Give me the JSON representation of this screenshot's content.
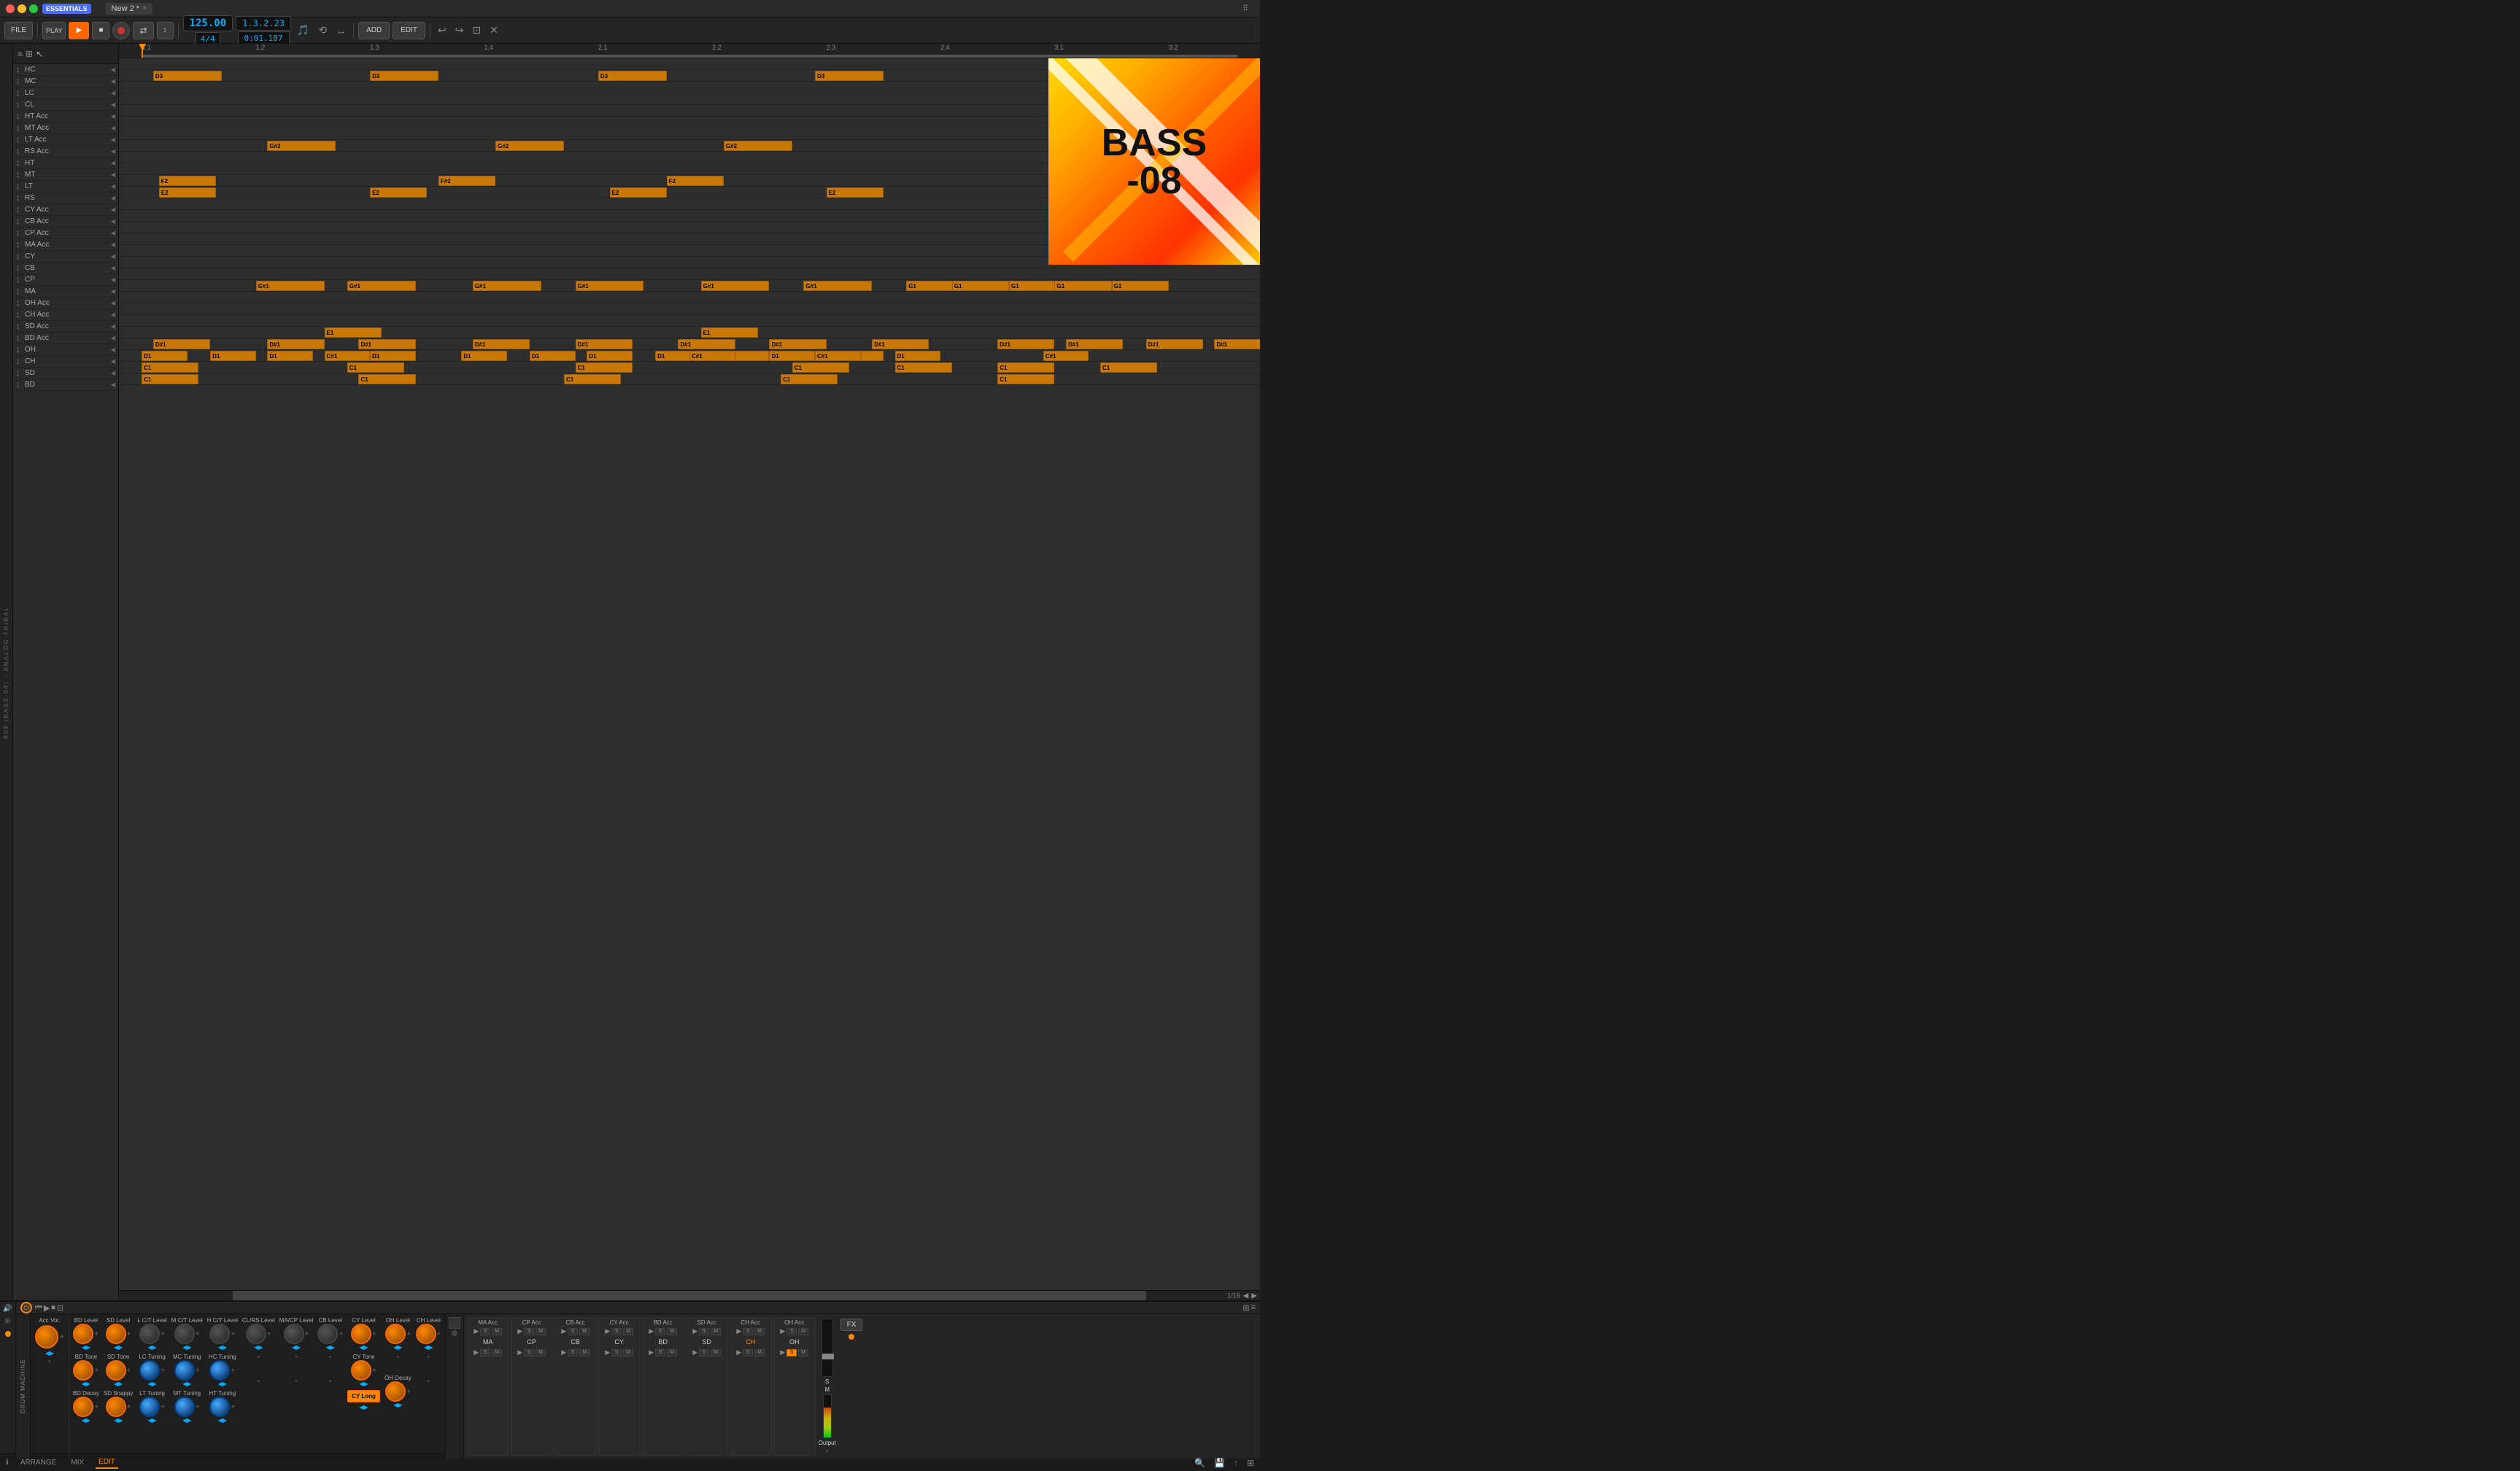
{
  "app": {
    "title": "ESSENTIALS",
    "tab_name": "New 2 *",
    "tab_close": "×"
  },
  "toolbar": {
    "file": "FILE",
    "play": "▶",
    "stop": "■",
    "record": "●",
    "tempo": "125.00",
    "time_sig": "4/4",
    "position": "1.3.2.23",
    "time": "0:01.107",
    "add": "ADD",
    "edit": "EDIT",
    "undo_icon": "↩",
    "redo_icon": "↪"
  },
  "arrange": {
    "ruler_marks": [
      "1.1",
      "1.2",
      "1.3",
      "1.4",
      "2.1",
      "2.2",
      "2.3",
      "2.4",
      "3.1",
      "3.2"
    ],
    "quantize": "1/16"
  },
  "tracks": [
    {
      "num": "1",
      "name": "HC"
    },
    {
      "num": "1",
      "name": "MC"
    },
    {
      "num": "1",
      "name": "LC"
    },
    {
      "num": "1",
      "name": "CL"
    },
    {
      "num": "1",
      "name": "HT Acc"
    },
    {
      "num": "1",
      "name": "MT Acc"
    },
    {
      "num": "1",
      "name": "LT Acc"
    },
    {
      "num": "1",
      "name": "RS Acc"
    },
    {
      "num": "1",
      "name": "HT"
    },
    {
      "num": "1",
      "name": "MT"
    },
    {
      "num": "1",
      "name": "LT"
    },
    {
      "num": "1",
      "name": "RS"
    },
    {
      "num": "1",
      "name": "CY Acc"
    },
    {
      "num": "1",
      "name": "CB Acc"
    },
    {
      "num": "1",
      "name": "CP Acc"
    },
    {
      "num": "1",
      "name": "MA Acc"
    },
    {
      "num": "1",
      "name": "CY"
    },
    {
      "num": "1",
      "name": "CB"
    },
    {
      "num": "1",
      "name": "CP"
    },
    {
      "num": "1",
      "name": "MA"
    },
    {
      "num": "1",
      "name": "OH Acc"
    },
    {
      "num": "1",
      "name": "CH Acc"
    },
    {
      "num": "1",
      "name": "SD Acc"
    },
    {
      "num": "1",
      "name": "BD Acc"
    },
    {
      "num": "1",
      "name": "OH"
    },
    {
      "num": "1",
      "name": "CH"
    },
    {
      "num": "1",
      "name": "SD"
    },
    {
      "num": "1",
      "name": "BD"
    }
  ],
  "album_art": {
    "text_line1": "BASS",
    "text_line2": "-08"
  },
  "bottom_panel": {
    "knobs": {
      "acc_vol": "Acc Vol.",
      "bd_level": "BD Level",
      "sd_level": "SD Level",
      "lct_level": "L C/T Level",
      "mct_level": "M C/T Level",
      "hct_level": "H C/T Level",
      "clrs_level": "CL/RS Level",
      "macp_level": "MA/CP Level",
      "cb_level": "CB Level",
      "cy_level": "CY Level",
      "oh_level": "OH Level",
      "ch_level": "CH Level",
      "bd_tone": "BD Tone",
      "sd_tone": "SD Tone",
      "lc_tuning": "LC Tuning",
      "mc_tuning": "MC Tuning",
      "hc_tuning": "HC Tuning",
      "cy_tone": "CY Tone",
      "oh_decay": "OH Decay",
      "bd_decay": "BD Decay",
      "sd_snappy": "SD Snappy",
      "lt_tuning": "LT Tuning",
      "mt_tuning": "MT Tuning",
      "ht_tuning": "HT Tuning"
    },
    "buttons": {
      "cy_long": "CY Long",
      "fx": "FX"
    },
    "channels": [
      {
        "label": "MA Acc",
        "name": "MA",
        "buttons": [
          "▶",
          "S",
          "M"
        ]
      },
      {
        "label": "CP Acc",
        "name": "CP",
        "buttons": [
          "▶",
          "S",
          "M"
        ]
      },
      {
        "label": "CB Acc",
        "name": "CB",
        "buttons": [
          "▶",
          "S",
          "M"
        ]
      },
      {
        "label": "CY Acc",
        "name": "CY",
        "buttons": [
          "▶",
          "S",
          "M"
        ]
      },
      {
        "label": "BD Acc",
        "name": "BD",
        "buttons": [
          "▶",
          "S",
          "M"
        ]
      },
      {
        "label": "SD Acc",
        "name": "SD",
        "buttons": [
          "▶",
          "S",
          "M"
        ]
      },
      {
        "label": "CH Acc",
        "name": "CH",
        "buttons": [
          "▶",
          "S",
          "M"
        ]
      },
      {
        "label": "OH Acc",
        "name": "OH",
        "buttons": [
          "▶",
          "S",
          "M"
        ]
      },
      {
        "label": "BD",
        "name": "BD",
        "buttons": [
          "▶",
          "S",
          "M"
        ]
      },
      {
        "label": "SD",
        "name": "SD",
        "buttons": [
          "▶",
          "S",
          "M"
        ]
      },
      {
        "label": "CH",
        "name": "CH",
        "buttons": [
          "▶",
          "S",
          "M"
        ]
      },
      {
        "label": "OH",
        "name": "OH",
        "buttons": [
          "▶",
          "S",
          "M"
        ]
      }
    ]
  },
  "status_bar": {
    "arrange": "ARRANGE",
    "mix": "MIX",
    "edit": "EDIT"
  },
  "side_label": "808 (BASS-08) - ANALOG TRIBAL"
}
